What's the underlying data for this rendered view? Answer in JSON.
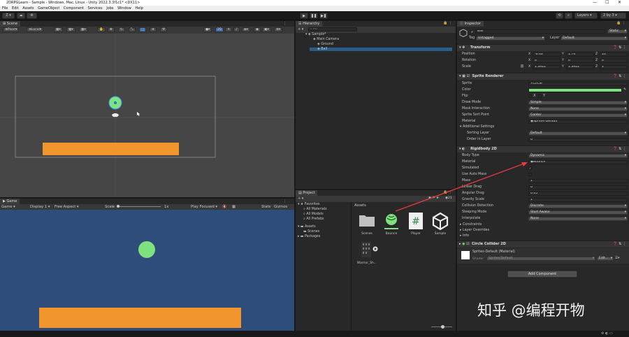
{
  "window": {
    "title": "2DRPGLearn - Sample - Windows, Mac, Linux - Unity 2022.3.3f1c1* <DX11>",
    "minimize": "—",
    "maximize": "☐",
    "close": "✕"
  },
  "menu": [
    "File",
    "Edit",
    "Assets",
    "GameObject",
    "Component",
    "Services",
    "Jobs",
    "Window",
    "Help"
  ],
  "toolbar": {
    "account": "Z",
    "layers": "Layers",
    "layout": "2 by 3"
  },
  "scene": {
    "tab": "Scene",
    "pivot": "Pivot",
    "local": "Local",
    "mode2d": "2D"
  },
  "game": {
    "tab": "Game",
    "mode": "Game",
    "display": "Display 1",
    "aspect": "Free Aspect",
    "scale_label": "Scale",
    "scale_value": "1x",
    "play_focused": "Play Focused",
    "stats": "Stats",
    "gizmos": "Gizmos"
  },
  "hierarchy": {
    "tab": "Hierarchy",
    "search_placeholder": "All",
    "scene_name": "Sample*",
    "items": [
      "Main Camera",
      "Ground",
      "Ball"
    ]
  },
  "project": {
    "tab": "Project",
    "count": "21",
    "tree": {
      "favorites": "Favorites",
      "fav_items": [
        "All Materials",
        "All Models",
        "All Prefabs"
      ],
      "assets": "Assets",
      "asset_items": [
        "Scenes"
      ],
      "packages": "Packages"
    },
    "breadcrumb": "Assets",
    "assets": [
      "Scenes",
      "Bounce",
      "Player",
      "Sample",
      "Warrior_Sh..."
    ]
  },
  "inspector": {
    "tab": "Inspector",
    "object_name": "Ball",
    "static_label": "Static",
    "tag_label": "Tag",
    "tag_value": "Untagged",
    "layer_label": "Layer",
    "layer_value": "Default",
    "transform": {
      "title": "Transform",
      "position_label": "Position",
      "rotation_label": "Rotation",
      "scale_label": "Scale",
      "axis_x": "X",
      "axis_y": "Y",
      "axis_z": "Z",
      "position": [
        "-0.02",
        "1.74",
        "10"
      ],
      "rotation": [
        "0",
        "0",
        "0"
      ],
      "scale": [
        "1.3922",
        "1.3922",
        "1"
      ]
    },
    "sprite_renderer": {
      "title": "Sprite Renderer",
      "sprite_label": "Sprite",
      "sprite_value": "Circle",
      "color_label": "Color",
      "color_value": "#7ee27e",
      "flip_label": "Flip",
      "flip_x": "X",
      "flip_y": "Y",
      "draw_mode_label": "Draw Mode",
      "draw_mode_value": "Simple",
      "mask_label": "Mask Interaction",
      "mask_value": "None",
      "sort_point_label": "Sprite Sort Point",
      "sort_point_value": "Center",
      "material_label": "Material",
      "material_value": "Sprites-Default",
      "additional_settings": "Additional Settings",
      "sorting_layer_label": "Sorting Layer",
      "sorting_layer_value": "Default",
      "order_label": "Order in Layer",
      "order_value": "0"
    },
    "rigidbody": {
      "title": "Rigidbody 2D",
      "body_type_label": "Body Type",
      "body_type_value": "Dynamic",
      "material_label": "Material",
      "material_value": "Bounce",
      "simulated_label": "Simulated",
      "auto_mass_label": "Use Auto Mass",
      "mass_label": "Mass",
      "mass_value": "1",
      "linear_drag_label": "Linear Drag",
      "linear_drag_value": "0",
      "angular_drag_label": "Angular Drag",
      "angular_drag_value": "0.05",
      "gravity_label": "Gravity Scale",
      "gravity_value": "1",
      "collision_label": "Collision Detection",
      "collision_value": "Discrete",
      "sleeping_label": "Sleeping Mode",
      "sleeping_value": "Start Awake",
      "interpolate_label": "Interpolate",
      "interpolate_value": "None",
      "constraints": "Constraints",
      "layer_overrides": "Layer Overrides",
      "info": "Info"
    },
    "circle_collider": {
      "title": "Circle Collider 2D"
    },
    "material_preview": {
      "title": "Sprites-Default (Material)",
      "shader_label": "Shader",
      "shader_value": "Sprites/Default",
      "edit_label": "Edit..."
    },
    "add_component": "Add Component"
  },
  "watermark": "知乎 @编程开物",
  "colors": {
    "ball": "#7ee27e",
    "ground": "#f0962d",
    "game_bg": "#2e4d7b",
    "scene_bg": "#464646",
    "arrow": "#e23c3c"
  }
}
